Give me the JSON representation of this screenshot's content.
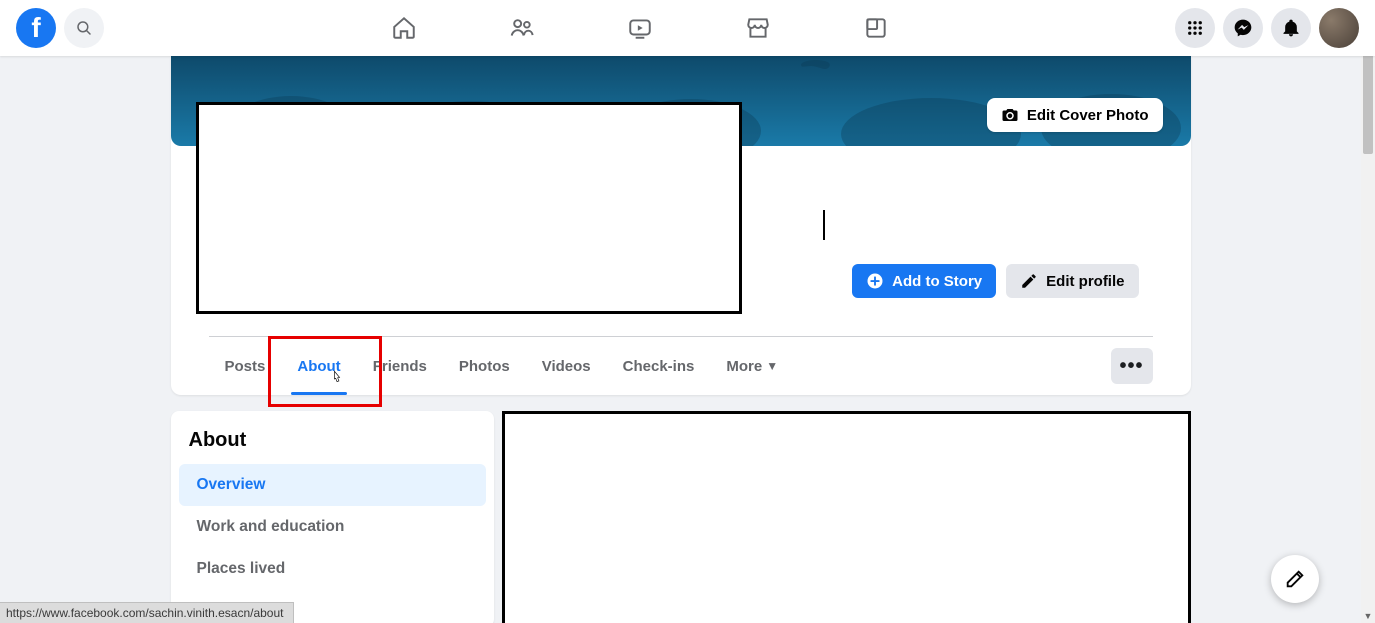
{
  "nav": {
    "search_placeholder": "Search Facebook"
  },
  "cover": {
    "edit_label": "Edit Cover Photo"
  },
  "actions": {
    "add_story": "Add to Story",
    "edit_profile": "Edit profile"
  },
  "tabs": [
    "Posts",
    "About",
    "Friends",
    "Photos",
    "Videos",
    "Check-ins"
  ],
  "tabs_more": "More",
  "active_tab_index": 1,
  "about": {
    "heading": "About",
    "items": [
      "Overview",
      "Work and education",
      "Places lived"
    ],
    "active_index": 0
  },
  "status_url": "https://www.facebook.com/sachin.vinith.esacn/about"
}
